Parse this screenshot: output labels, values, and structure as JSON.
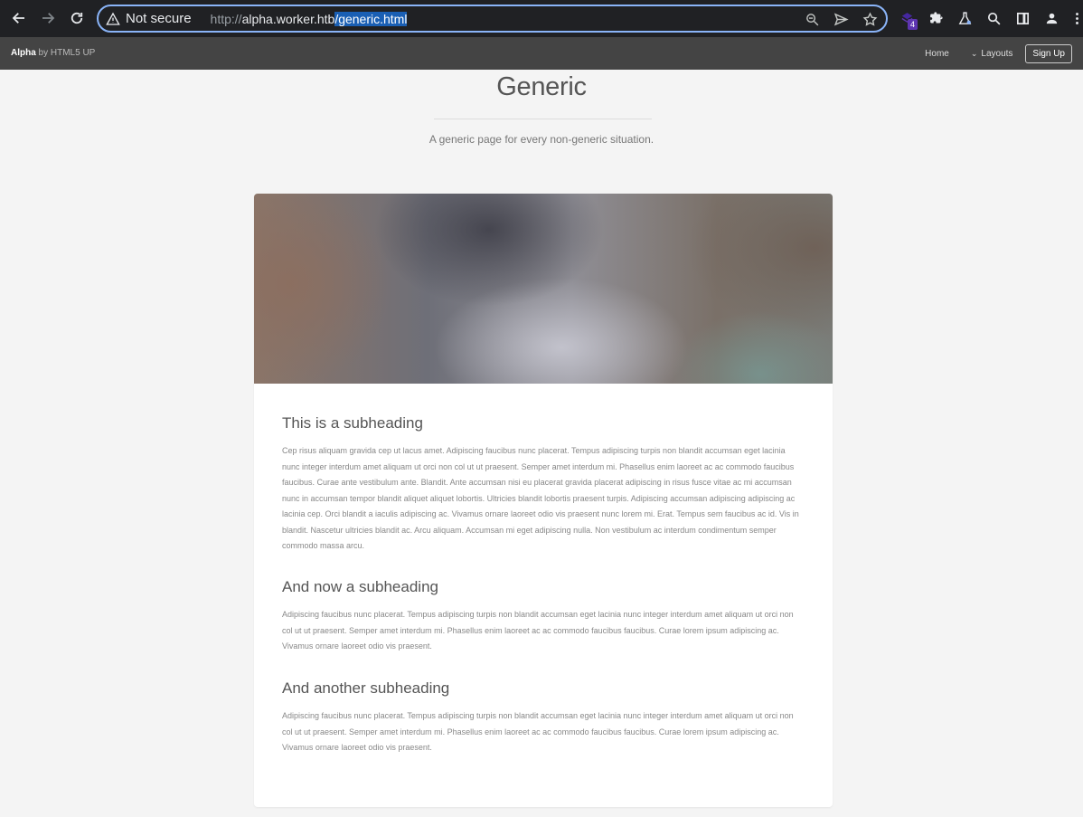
{
  "browser": {
    "security_label": "Not secure",
    "url_scheme": "http://",
    "url_host": "alpha.worker.htb",
    "url_path": "/generic.html",
    "extension_badge": "4",
    "accent_color": "#8ab4f8"
  },
  "site": {
    "brand_name": "Alpha",
    "brand_suffix": " by HTML5 UP",
    "nav": {
      "home": "Home",
      "layouts": "Layouts",
      "signup": "Sign Up"
    }
  },
  "page": {
    "title": "Generic",
    "subtitle": "A generic page for every non-generic situation.",
    "sections": [
      {
        "heading": "This is a subheading",
        "body": "Cep risus aliquam gravida cep ut lacus amet. Adipiscing faucibus nunc placerat. Tempus adipiscing turpis non blandit accumsan eget lacinia nunc integer interdum amet aliquam ut orci non col ut ut praesent. Semper amet interdum mi. Phasellus enim laoreet ac ac commodo faucibus faucibus. Curae ante vestibulum ante. Blandit. Ante accumsan nisi eu placerat gravida placerat adipiscing in risus fusce vitae ac mi accumsan nunc in accumsan tempor blandit aliquet aliquet lobortis. Ultricies blandit lobortis praesent turpis. Adipiscing accumsan adipiscing adipiscing ac lacinia cep. Orci blandit a iaculis adipiscing ac. Vivamus ornare laoreet odio vis praesent nunc lorem mi. Erat. Tempus sem faucibus ac id. Vis in blandit. Nascetur ultricies blandit ac. Arcu aliquam. Accumsan mi eget adipiscing nulla. Non vestibulum ac interdum condimentum semper commodo massa arcu."
      },
      {
        "heading": "And now a subheading",
        "body": "Adipiscing faucibus nunc placerat. Tempus adipiscing turpis non blandit accumsan eget lacinia nunc integer interdum amet aliquam ut orci non col ut ut praesent. Semper amet interdum mi. Phasellus enim laoreet ac ac commodo faucibus faucibus. Curae lorem ipsum adipiscing ac. Vivamus ornare laoreet odio vis praesent."
      },
      {
        "heading": "And another subheading",
        "body": "Adipiscing faucibus nunc placerat. Tempus adipiscing turpis non blandit accumsan eget lacinia nunc integer interdum amet aliquam ut orci non col ut ut praesent. Semper amet interdum mi. Phasellus enim laoreet ac ac commodo faucibus faucibus. Curae lorem ipsum adipiscing ac. Vivamus ornare laoreet odio vis praesent."
      }
    ]
  }
}
